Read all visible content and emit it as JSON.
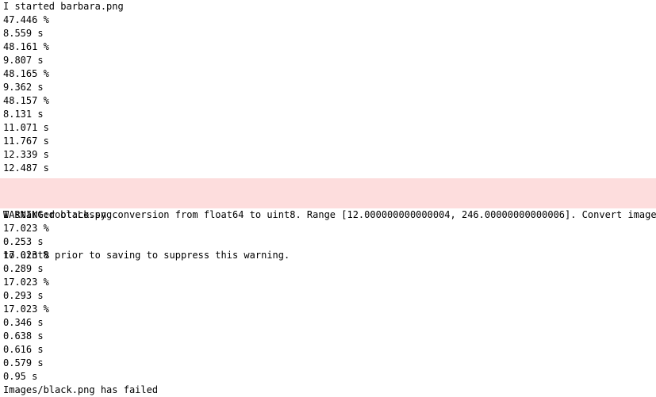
{
  "output": {
    "block1": [
      "I started barbara.png",
      "47.446 %",
      "8.559 s",
      "48.161 %",
      "9.807 s",
      "48.165 %",
      "9.362 s",
      "48.157 %",
      "8.131 s",
      "11.071 s",
      "11.767 s",
      "12.339 s",
      "12.487 s"
    ],
    "warning": {
      "line1": "WARNING:root:Lossy conversion from float64 to uint8. Range [12.000000000000004, 246.00000000000006]. Convert image",
      "line2": "to uint8 prior to saving to suppress this warning."
    },
    "block2": [
      "I started black.png",
      "17.023 %",
      "0.253 s",
      "17.023 %",
      "0.289 s",
      "17.023 %",
      "0.293 s",
      "17.023 %",
      "0.346 s",
      "0.638 s",
      "0.616 s",
      "0.579 s",
      "0.95 s",
      "Images/black.png has failed"
    ]
  },
  "colors": {
    "background": "#ffffff",
    "text": "#000000",
    "warning_background": "#fddddd"
  }
}
